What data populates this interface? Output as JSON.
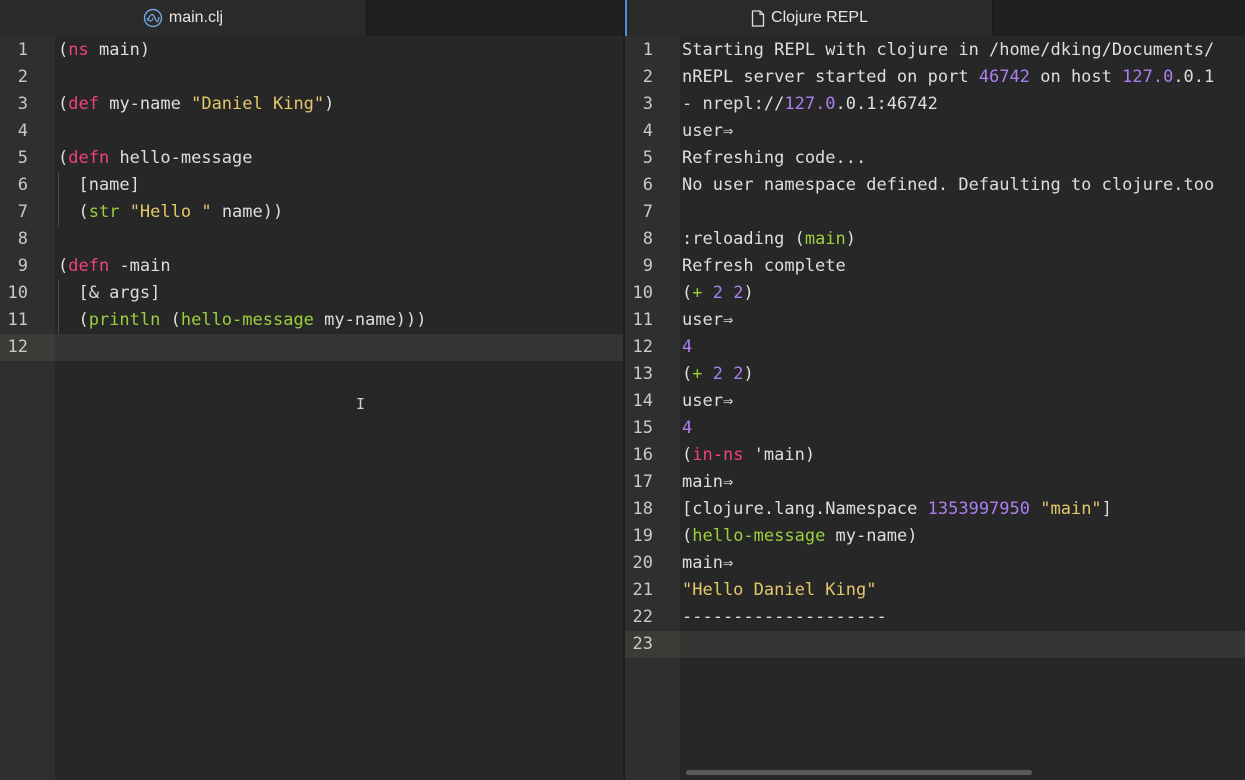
{
  "left_pane": {
    "tab": {
      "title": "main.clj",
      "icon": "clojure-logo-icon"
    },
    "lines": [
      {
        "n": "1",
        "tokens": [
          {
            "t": "("
          },
          {
            "t": "ns",
            "c": "k"
          },
          {
            "t": " main)"
          }
        ]
      },
      {
        "n": "2",
        "tokens": []
      },
      {
        "n": "3",
        "tokens": [
          {
            "t": "("
          },
          {
            "t": "def",
            "c": "k"
          },
          {
            "t": " my-name "
          },
          {
            "t": "\"Daniel King\"",
            "c": "s"
          },
          {
            "t": ")"
          }
        ]
      },
      {
        "n": "4",
        "tokens": []
      },
      {
        "n": "5",
        "tokens": [
          {
            "t": "("
          },
          {
            "t": "defn",
            "c": "k"
          },
          {
            "t": " hello-message"
          }
        ]
      },
      {
        "n": "6",
        "tokens": [
          {
            "t": "  [name]"
          }
        ]
      },
      {
        "n": "7",
        "tokens": [
          {
            "t": "  ("
          },
          {
            "t": "str",
            "c": "f"
          },
          {
            "t": " "
          },
          {
            "t": "\"Hello \"",
            "c": "s"
          },
          {
            "t": " name))"
          }
        ]
      },
      {
        "n": "8",
        "tokens": []
      },
      {
        "n": "9",
        "tokens": [
          {
            "t": "("
          },
          {
            "t": "defn",
            "c": "k"
          },
          {
            "t": " -main"
          }
        ]
      },
      {
        "n": "10",
        "tokens": [
          {
            "t": "  [& args]"
          }
        ]
      },
      {
        "n": "11",
        "tokens": [
          {
            "t": "  ("
          },
          {
            "t": "println",
            "c": "f"
          },
          {
            "t": " ("
          },
          {
            "t": "hello-message",
            "c": "f"
          },
          {
            "t": " my-name)))"
          }
        ]
      },
      {
        "n": "12",
        "tokens": [],
        "current": true
      }
    ]
  },
  "right_pane": {
    "tab": {
      "title": "Clojure REPL",
      "icon": "file-icon"
    },
    "lines": [
      {
        "n": "1",
        "tokens": [
          {
            "t": "Starting REPL with clojure in /home/dking/Documents/"
          }
        ]
      },
      {
        "n": "2",
        "tokens": [
          {
            "t": "nREPL server started on port "
          },
          {
            "t": "46742",
            "c": "n"
          },
          {
            "t": " on host "
          },
          {
            "t": "127.0",
            "c": "n"
          },
          {
            "t": ".0.1"
          }
        ]
      },
      {
        "n": "3",
        "tokens": [
          {
            "t": "- nrepl://"
          },
          {
            "t": "127.0",
            "c": "n"
          },
          {
            "t": ".0.1:46742"
          }
        ]
      },
      {
        "n": "4",
        "tokens": [
          {
            "t": "user⇒"
          }
        ]
      },
      {
        "n": "5",
        "tokens": [
          {
            "t": "Refreshing code..."
          }
        ]
      },
      {
        "n": "6",
        "tokens": [
          {
            "t": "No user namespace defined. Defaulting to clojure.too"
          }
        ]
      },
      {
        "n": "7",
        "tokens": []
      },
      {
        "n": "8",
        "tokens": [
          {
            "t": ":reloading ("
          },
          {
            "t": "main",
            "c": "f"
          },
          {
            "t": ")"
          }
        ]
      },
      {
        "n": "9",
        "tokens": [
          {
            "t": "Refresh complete"
          }
        ]
      },
      {
        "n": "10",
        "tokens": [
          {
            "t": "("
          },
          {
            "t": "+",
            "c": "f"
          },
          {
            "t": " "
          },
          {
            "t": "2",
            "c": "n"
          },
          {
            "t": " "
          },
          {
            "t": "2",
            "c": "n"
          },
          {
            "t": ")"
          }
        ]
      },
      {
        "n": "11",
        "tokens": [
          {
            "t": "user⇒"
          }
        ]
      },
      {
        "n": "12",
        "tokens": [
          {
            "t": "4",
            "c": "n"
          }
        ]
      },
      {
        "n": "13",
        "tokens": [
          {
            "t": "("
          },
          {
            "t": "+",
            "c": "f"
          },
          {
            "t": " "
          },
          {
            "t": "2",
            "c": "n"
          },
          {
            "t": " "
          },
          {
            "t": "2",
            "c": "n"
          },
          {
            "t": ")"
          }
        ]
      },
      {
        "n": "14",
        "tokens": [
          {
            "t": "user⇒"
          }
        ]
      },
      {
        "n": "15",
        "tokens": [
          {
            "t": "4",
            "c": "n"
          }
        ]
      },
      {
        "n": "16",
        "tokens": [
          {
            "t": "("
          },
          {
            "t": "in-ns",
            "c": "k"
          },
          {
            "t": " 'main)"
          }
        ]
      },
      {
        "n": "17",
        "tokens": [
          {
            "t": "main⇒"
          }
        ]
      },
      {
        "n": "18",
        "tokens": [
          {
            "t": "[clojure.lang.Namespace "
          },
          {
            "t": "1353997950",
            "c": "n"
          },
          {
            "t": " "
          },
          {
            "t": "\"main\"",
            "c": "s"
          },
          {
            "t": "]"
          }
        ]
      },
      {
        "n": "19",
        "tokens": [
          {
            "t": "("
          },
          {
            "t": "hello-message",
            "c": "f"
          },
          {
            "t": " my-name)"
          }
        ]
      },
      {
        "n": "20",
        "tokens": [
          {
            "t": "main⇒"
          }
        ]
      },
      {
        "n": "21",
        "tokens": [
          {
            "t": "\"Hello Daniel King\"",
            "c": "s"
          }
        ]
      },
      {
        "n": "22",
        "tokens": [
          {
            "t": "--------------------"
          }
        ]
      },
      {
        "n": "23",
        "tokens": [],
        "current": true
      }
    ]
  },
  "colors": {
    "keyword": "#f0417a",
    "function": "#9ccf3c",
    "string": "#e5c76b",
    "number": "#ab7ff0",
    "active_tab_accent": "#4a90d9"
  }
}
